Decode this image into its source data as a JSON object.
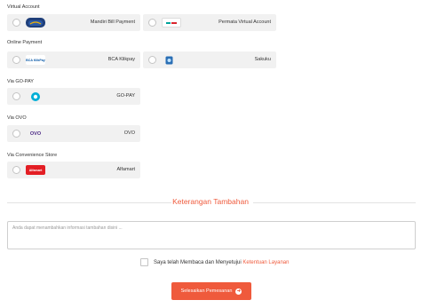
{
  "sections": {
    "virtual_account": "Virtual Account",
    "online_payment": "Online Payment",
    "gopay": "Via GO-PAY",
    "ovo": "Via OVO",
    "convenience": "Via Convenience Store"
  },
  "methods": {
    "mandiri": {
      "label": "Mandiri Bill Payment",
      "logo_icon": "mandiri-logo"
    },
    "permata": {
      "label": "Permata Virtual Account",
      "logo_icon": "permata-logo"
    },
    "bca": {
      "label": "BCA Klikpay",
      "logo_icon": "bca-klikpay-logo",
      "logo_text": "BCA KlikPay"
    },
    "sakuku": {
      "label": "Sakuku",
      "logo_icon": "sakuku-logo"
    },
    "gopay": {
      "label": "GO-PAY",
      "logo_icon": "gopay-logo"
    },
    "ovo": {
      "label": "OVO",
      "logo_icon": "ovo-logo",
      "logo_text": "OVO"
    },
    "alfamart": {
      "label": "Alfamart",
      "logo_icon": "alfamart-logo",
      "logo_text": "Alfamart"
    }
  },
  "notes": {
    "heading": "Keterangan Tambahan",
    "placeholder": "Anda dapat menambahkan informasi tambahan disini ..."
  },
  "agreement": {
    "text": "Saya telah Membaca dan Menyetujui ",
    "link": "Ketentuan Layanan"
  },
  "submit": {
    "label": "Selesaikan Pemesanan",
    "icon": "arrow-right-circle-icon"
  },
  "colors": {
    "accent": "#ef5a3c",
    "card_bg": "#f1f1f1"
  }
}
